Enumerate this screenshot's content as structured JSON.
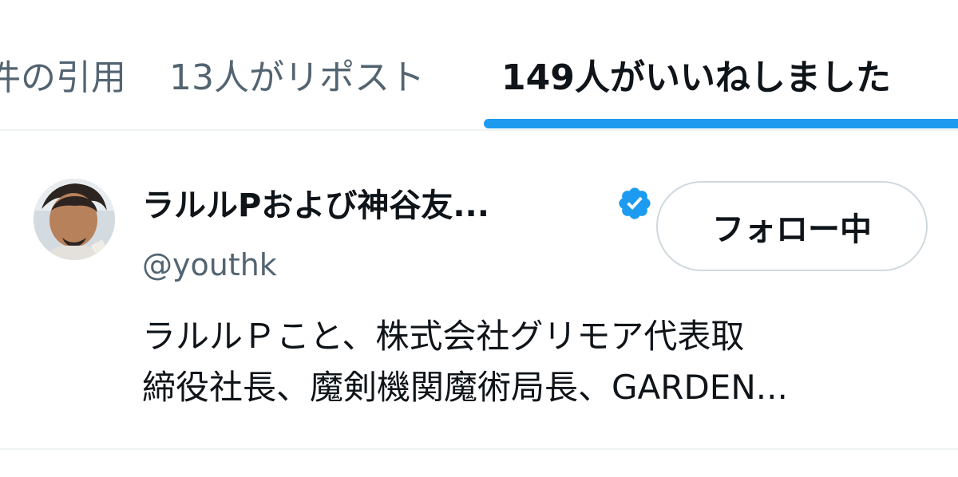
{
  "tabs": {
    "quotes_label": "件の引用",
    "reposts_label": "13人がリポスト",
    "likes_label": "149人がいいねしました",
    "active": "likes"
  },
  "colors": {
    "accent": "#1d9bf0",
    "text_primary": "#0f1419",
    "text_secondary": "#536471",
    "border": "#cfd9de"
  },
  "user": {
    "name": "ラルルPおよび神谷友...",
    "handle": "@youthk",
    "verified": true,
    "verified_icon": "verified-badge-icon",
    "follow_button_label": "フォロー中",
    "bio_lines": [
      "ラルルＰこと、株式会社グリモア代表取",
      "締役社長、魔剣機関魔術局長、GARDEN..."
    ]
  }
}
